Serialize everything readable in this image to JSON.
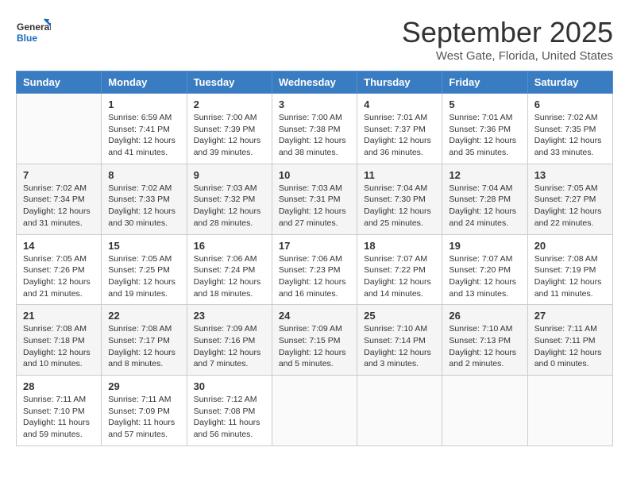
{
  "logo": {
    "general": "General",
    "blue": "Blue"
  },
  "title": "September 2025",
  "location": "West Gate, Florida, United States",
  "weekdays": [
    "Sunday",
    "Monday",
    "Tuesday",
    "Wednesday",
    "Thursday",
    "Friday",
    "Saturday"
  ],
  "weeks": [
    [
      {
        "day": "",
        "info": ""
      },
      {
        "day": "1",
        "info": "Sunrise: 6:59 AM\nSunset: 7:41 PM\nDaylight: 12 hours\nand 41 minutes."
      },
      {
        "day": "2",
        "info": "Sunrise: 7:00 AM\nSunset: 7:39 PM\nDaylight: 12 hours\nand 39 minutes."
      },
      {
        "day": "3",
        "info": "Sunrise: 7:00 AM\nSunset: 7:38 PM\nDaylight: 12 hours\nand 38 minutes."
      },
      {
        "day": "4",
        "info": "Sunrise: 7:01 AM\nSunset: 7:37 PM\nDaylight: 12 hours\nand 36 minutes."
      },
      {
        "day": "5",
        "info": "Sunrise: 7:01 AM\nSunset: 7:36 PM\nDaylight: 12 hours\nand 35 minutes."
      },
      {
        "day": "6",
        "info": "Sunrise: 7:02 AM\nSunset: 7:35 PM\nDaylight: 12 hours\nand 33 minutes."
      }
    ],
    [
      {
        "day": "7",
        "info": "Sunrise: 7:02 AM\nSunset: 7:34 PM\nDaylight: 12 hours\nand 31 minutes."
      },
      {
        "day": "8",
        "info": "Sunrise: 7:02 AM\nSunset: 7:33 PM\nDaylight: 12 hours\nand 30 minutes."
      },
      {
        "day": "9",
        "info": "Sunrise: 7:03 AM\nSunset: 7:32 PM\nDaylight: 12 hours\nand 28 minutes."
      },
      {
        "day": "10",
        "info": "Sunrise: 7:03 AM\nSunset: 7:31 PM\nDaylight: 12 hours\nand 27 minutes."
      },
      {
        "day": "11",
        "info": "Sunrise: 7:04 AM\nSunset: 7:30 PM\nDaylight: 12 hours\nand 25 minutes."
      },
      {
        "day": "12",
        "info": "Sunrise: 7:04 AM\nSunset: 7:28 PM\nDaylight: 12 hours\nand 24 minutes."
      },
      {
        "day": "13",
        "info": "Sunrise: 7:05 AM\nSunset: 7:27 PM\nDaylight: 12 hours\nand 22 minutes."
      }
    ],
    [
      {
        "day": "14",
        "info": "Sunrise: 7:05 AM\nSunset: 7:26 PM\nDaylight: 12 hours\nand 21 minutes."
      },
      {
        "day": "15",
        "info": "Sunrise: 7:05 AM\nSunset: 7:25 PM\nDaylight: 12 hours\nand 19 minutes."
      },
      {
        "day": "16",
        "info": "Sunrise: 7:06 AM\nSunset: 7:24 PM\nDaylight: 12 hours\nand 18 minutes."
      },
      {
        "day": "17",
        "info": "Sunrise: 7:06 AM\nSunset: 7:23 PM\nDaylight: 12 hours\nand 16 minutes."
      },
      {
        "day": "18",
        "info": "Sunrise: 7:07 AM\nSunset: 7:22 PM\nDaylight: 12 hours\nand 14 minutes."
      },
      {
        "day": "19",
        "info": "Sunrise: 7:07 AM\nSunset: 7:20 PM\nDaylight: 12 hours\nand 13 minutes."
      },
      {
        "day": "20",
        "info": "Sunrise: 7:08 AM\nSunset: 7:19 PM\nDaylight: 12 hours\nand 11 minutes."
      }
    ],
    [
      {
        "day": "21",
        "info": "Sunrise: 7:08 AM\nSunset: 7:18 PM\nDaylight: 12 hours\nand 10 minutes."
      },
      {
        "day": "22",
        "info": "Sunrise: 7:08 AM\nSunset: 7:17 PM\nDaylight: 12 hours\nand 8 minutes."
      },
      {
        "day": "23",
        "info": "Sunrise: 7:09 AM\nSunset: 7:16 PM\nDaylight: 12 hours\nand 7 minutes."
      },
      {
        "day": "24",
        "info": "Sunrise: 7:09 AM\nSunset: 7:15 PM\nDaylight: 12 hours\nand 5 minutes."
      },
      {
        "day": "25",
        "info": "Sunrise: 7:10 AM\nSunset: 7:14 PM\nDaylight: 12 hours\nand 3 minutes."
      },
      {
        "day": "26",
        "info": "Sunrise: 7:10 AM\nSunset: 7:13 PM\nDaylight: 12 hours\nand 2 minutes."
      },
      {
        "day": "27",
        "info": "Sunrise: 7:11 AM\nSunset: 7:11 PM\nDaylight: 12 hours\nand 0 minutes."
      }
    ],
    [
      {
        "day": "28",
        "info": "Sunrise: 7:11 AM\nSunset: 7:10 PM\nDaylight: 11 hours\nand 59 minutes."
      },
      {
        "day": "29",
        "info": "Sunrise: 7:11 AM\nSunset: 7:09 PM\nDaylight: 11 hours\nand 57 minutes."
      },
      {
        "day": "30",
        "info": "Sunrise: 7:12 AM\nSunset: 7:08 PM\nDaylight: 11 hours\nand 56 minutes."
      },
      {
        "day": "",
        "info": ""
      },
      {
        "day": "",
        "info": ""
      },
      {
        "day": "",
        "info": ""
      },
      {
        "day": "",
        "info": ""
      }
    ]
  ]
}
